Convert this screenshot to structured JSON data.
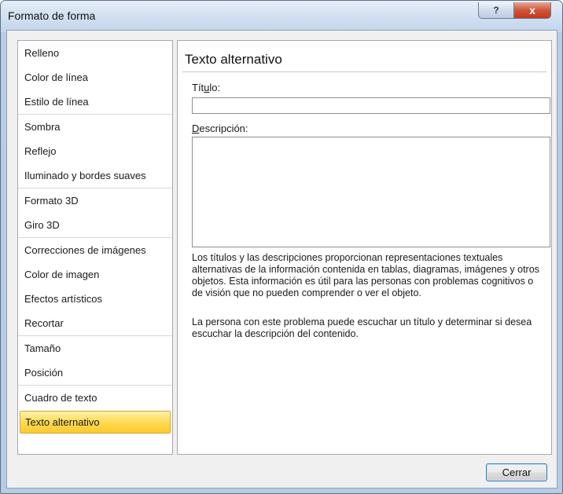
{
  "window": {
    "title": "Formato de forma",
    "help_glyph": "?",
    "close_glyph": "x"
  },
  "nav": {
    "groups": [
      [
        {
          "label": "Relleno"
        },
        {
          "label": "Color de línea"
        },
        {
          "label": "Estilo de línea"
        }
      ],
      [
        {
          "label": "Sombra"
        },
        {
          "label": "Reflejo"
        },
        {
          "label": "Iluminado y bordes suaves"
        }
      ],
      [
        {
          "label": "Formato 3D"
        },
        {
          "label": "Giro 3D"
        }
      ],
      [
        {
          "label": "Correcciones de imágenes"
        },
        {
          "label": "Color de imagen"
        },
        {
          "label": "Efectos artísticos"
        },
        {
          "label": "Recortar"
        }
      ],
      [
        {
          "label": "Tamaño"
        },
        {
          "label": "Posición"
        }
      ],
      [
        {
          "label": "Cuadro de texto"
        },
        {
          "label": "Texto alternativo",
          "selected": true
        }
      ]
    ]
  },
  "pane": {
    "heading": "Texto alternativo",
    "title_label": {
      "pre": "Tít",
      "accel": "u",
      "post": "lo:"
    },
    "title_value": "",
    "desc_label": {
      "pre": "",
      "accel": "D",
      "post": "escripción:"
    },
    "desc_value": "",
    "help_text_1": "Los títulos y las descripciones proporcionan representaciones textuales alternativas de la información contenida en tablas, diagramas, imágenes y otros objetos. Esta información es útil para las personas con problemas cognitivos o de visión que no pueden comprender o ver el objeto.",
    "help_text_2": "La persona con este problema puede escuchar un título y determinar si desea escuchar la descripción del contenido."
  },
  "footer": {
    "close_label": "Cerrar"
  },
  "colors": {
    "selected_item": "#ffd94e",
    "close_button": "#c3381c",
    "focus_border": "#3c7fb1"
  }
}
